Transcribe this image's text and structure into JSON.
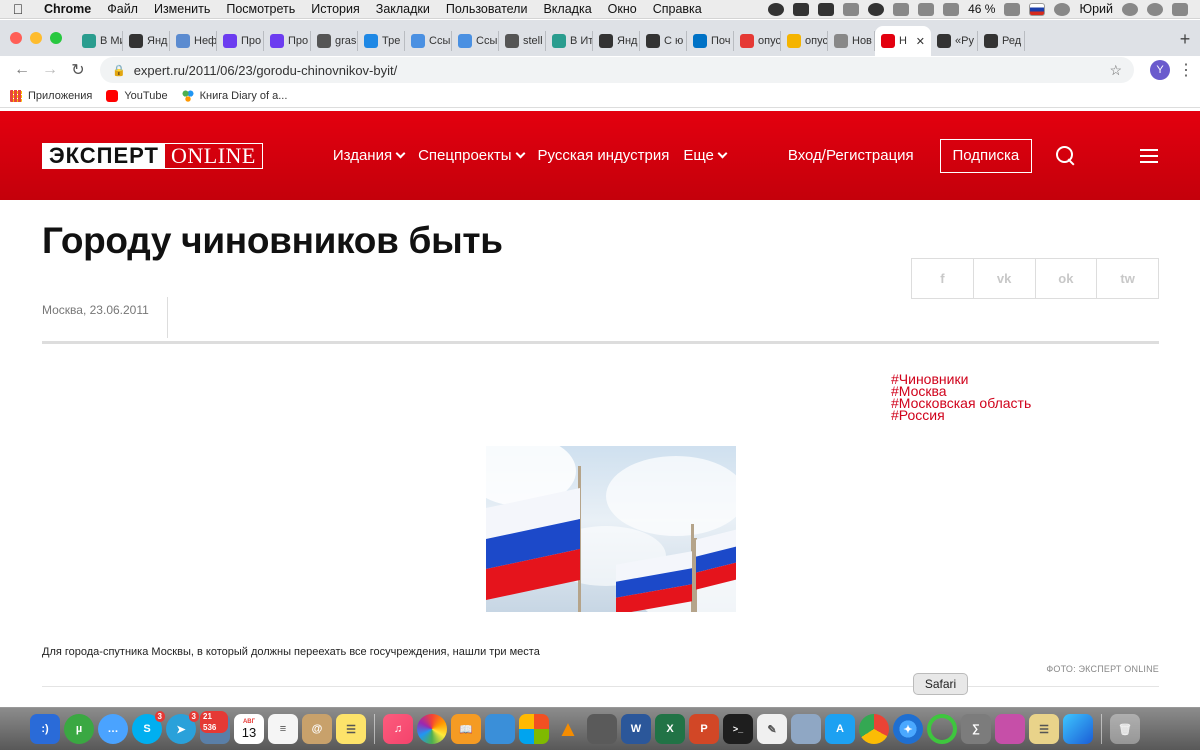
{
  "menubar": {
    "app": "Chrome",
    "items": [
      "Файл",
      "Изменить",
      "Посмотреть",
      "История",
      "Закладки",
      "Пользователи",
      "Вкладка",
      "Окно",
      "Справка"
    ],
    "battery": "46 %",
    "user": "Юрий"
  },
  "tabs": [
    {
      "label": "В Ми",
      "color": "#2a9d8f"
    },
    {
      "label": "Янд",
      "color": "#333333"
    },
    {
      "label": "Неф",
      "color": "#5b8bd0"
    },
    {
      "label": "Про",
      "color": "#6c3cf0"
    },
    {
      "label": "Про",
      "color": "#6c3cf0"
    },
    {
      "label": "gras",
      "color": "#555555"
    },
    {
      "label": "Тре",
      "color": "#1e88e5"
    },
    {
      "label": "Ссы",
      "color": "#4a90e2"
    },
    {
      "label": "Ссы",
      "color": "#4a90e2"
    },
    {
      "label": "stell",
      "color": "#555555"
    },
    {
      "label": "В Ит",
      "color": "#2a9d8f"
    },
    {
      "label": "Янд",
      "color": "#333333"
    },
    {
      "label": "С ю",
      "color": "#333333"
    },
    {
      "label": "Поч",
      "color": "#0072c6"
    },
    {
      "label": "опус",
      "color": "#e53935"
    },
    {
      "label": "опус",
      "color": "#f5b400"
    },
    {
      "label": "Нов",
      "color": "#888888"
    },
    {
      "label": "Н",
      "color": "#e3000f",
      "active": true
    },
    {
      "label": "«Ру",
      "color": "#333333"
    },
    {
      "label": "Ред",
      "color": "#333333"
    }
  ],
  "omnibox": {
    "url": "expert.ru/2011/06/23/gorodu-chinovnikov-byit/",
    "avatar_letter": "Y"
  },
  "bookmarks": [
    {
      "label": "Приложения",
      "icon": "apps-grid-icon"
    },
    {
      "label": "YouTube",
      "icon": "youtube-icon"
    },
    {
      "label": "Книга Diary of a...",
      "icon": "diary-icon"
    }
  ],
  "site": {
    "logo_part1": "ЭКСПЕРТ",
    "logo_part2": "ONLINE",
    "nav": [
      {
        "label": "Издания",
        "dropdown": true
      },
      {
        "label": "Спецпроекты",
        "dropdown": true
      },
      {
        "label": "Русская индустрия",
        "dropdown": false
      },
      {
        "label": "Еще",
        "dropdown": true
      }
    ],
    "login": "Вход/Регистрация",
    "subscribe": "Подписка",
    "brand_color": "#e3000f"
  },
  "article": {
    "title": "Городу чиновников быть",
    "dateline": "Москва, 23.06.2011",
    "share": [
      "f",
      "vk",
      "ok",
      "tw"
    ],
    "tags": [
      "#Чиновники",
      "#Москва",
      "#Московская область",
      "#Россия"
    ],
    "caption": "Для города-спутника Москвы, в который должны переехать все госучреждения, нашли три места",
    "photo_credit": "ФОТО: ЭКСПЕРТ ONLINE"
  },
  "dock": {
    "tooltip": "Safari",
    "calendar_month": "АВГ",
    "calendar_day": "13",
    "badges": {
      "skype": "3",
      "telegram": "3",
      "photos": "21 536"
    }
  }
}
